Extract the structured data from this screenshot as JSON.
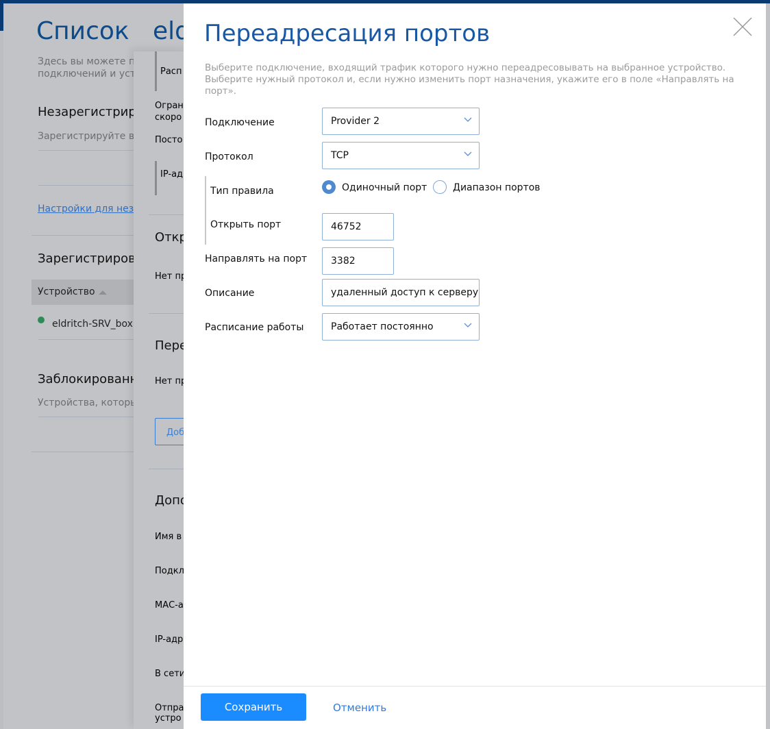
{
  "background": {
    "page_title": "Список",
    "device_title_fragment": "eld",
    "intro_fragments": [
      "Здесь вы можете п",
      "подключений и уст"
    ],
    "unregistered_title": "Незарегистрир",
    "unregistered_desc": "Зарегистрируйте ва",
    "unregistered_link": "Настройки для неза",
    "registered_title": "Зарегистрирова",
    "column_device": "Устройство",
    "device_name": "eldritch-SRV_box",
    "blocked_title": "Заблокированн",
    "blocked_desc": "Устройства, которь",
    "panel": {
      "items": [
        "Расп",
        "Огран",
        "скоро",
        "Посто",
        "IP-ад",
        "Откр",
        "Нет пр",
        "Пере",
        "Нет пр",
        "Доб",
        "Допо",
        "Имя в",
        "Подкл",
        "МАС-а",
        "IP-адр",
        "В сети",
        "Отпра",
        "устро"
      ]
    }
  },
  "modal": {
    "title": "Переадресация портов",
    "description": "Выберите подключение, входящий трафик которого нужно переадресовывать на выбранное устройство. Выберите нужный протокол и, если нужно изменить порт назначения, укажите его в поле «Направлять на порт».",
    "fields": {
      "connection": {
        "label": "Подключение",
        "value": "Provider 2"
      },
      "protocol": {
        "label": "Протокол",
        "value": "TCP"
      },
      "rule_type": {
        "label": "Тип правила",
        "options": [
          "Одиночный порт",
          "Диапазон портов"
        ],
        "selected": 0
      },
      "open_port": {
        "label": "Открыть порт",
        "value": "46752"
      },
      "forward_port": {
        "label": "Направлять на порт",
        "value": "3382"
      },
      "description": {
        "label": "Описание",
        "value": "удаленный доступ к серверу"
      },
      "schedule": {
        "label": "Расписание работы",
        "value": "Работает постоянно"
      }
    },
    "save_label": "Сохранить",
    "cancel_label": "Отменить"
  },
  "colors": {
    "accent": "#1a8cff",
    "title": "#1858a4",
    "online": "#2e8b57"
  }
}
